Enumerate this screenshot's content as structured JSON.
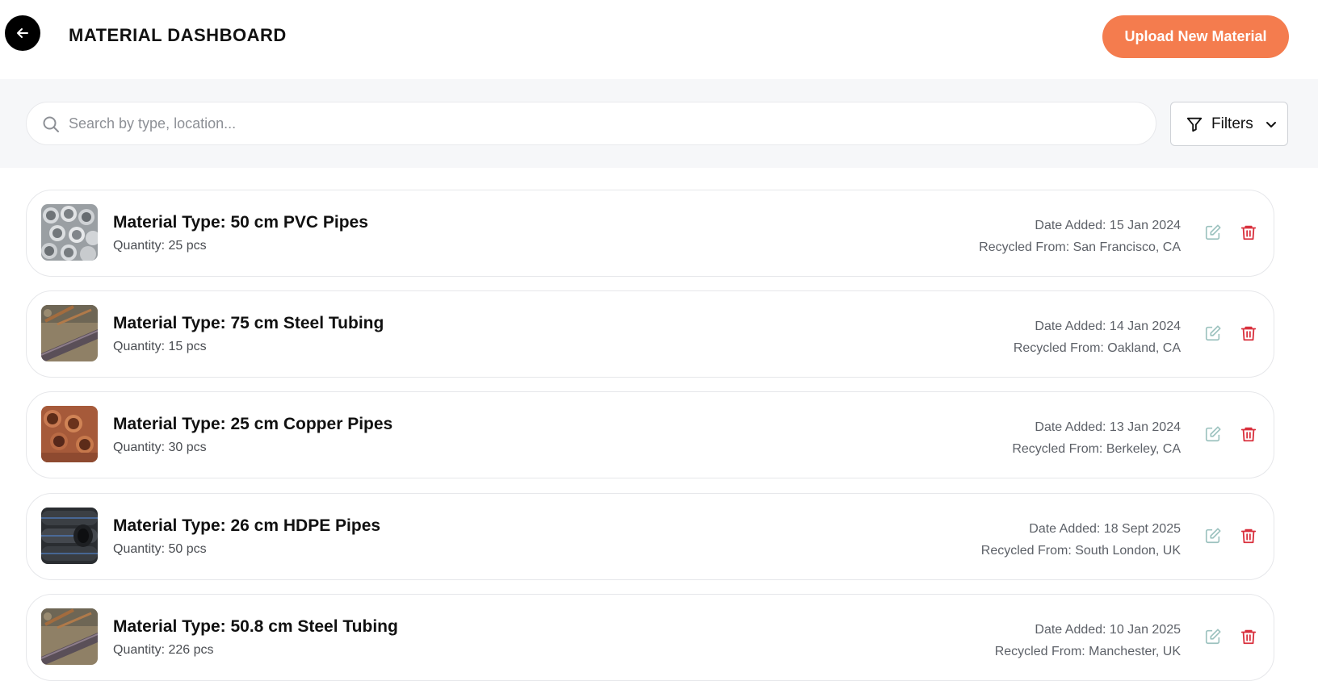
{
  "header": {
    "title": "MATERIAL DASHBOARD",
    "upload_label": "Upload New Material"
  },
  "search": {
    "placeholder": "Search by type, location...",
    "value": ""
  },
  "filters": {
    "label": "Filters"
  },
  "colors": {
    "accent": "#f47c4e",
    "delete": "#d9303d",
    "edit": "#9cc2bf"
  },
  "materials": [
    {
      "type": "Material Type: 50 cm PVC Pipes",
      "quantity": "Quantity: 25 pcs",
      "date": "Date Added: 15 Jan 2024",
      "from": "Recycled From: San Francisco, CA"
    },
    {
      "type": "Material Type: 75 cm Steel Tubing",
      "quantity": "Quantity: 15 pcs",
      "date": "Date Added: 14 Jan 2024",
      "from": "Recycled From: Oakland, CA"
    },
    {
      "type": "Material Type: 25 cm Copper Pipes",
      "quantity": "Quantity: 30 pcs",
      "date": "Date Added: 13 Jan 2024",
      "from": "Recycled From: Berkeley, CA"
    },
    {
      "type": "Material Type: 26 cm HDPE Pipes",
      "quantity": "Quantity: 50 pcs",
      "date": "Date Added: 18 Sept 2025",
      "from": "Recycled From: South London, UK"
    },
    {
      "type": "Material Type: 50.8 cm Steel Tubing",
      "quantity": "Quantity: 226 pcs",
      "date": "Date Added: 10 Jan 2025",
      "from": "Recycled From: Manchester, UK"
    }
  ]
}
